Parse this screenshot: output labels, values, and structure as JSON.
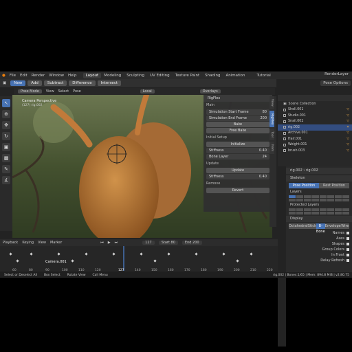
{
  "menubar": {
    "items": [
      "File",
      "Edit",
      "Render",
      "Window",
      "Help"
    ],
    "workspaces": [
      "Layout",
      "Modeling",
      "Sculpting",
      "UV Editing",
      "Texture Paint",
      "Shading",
      "Animation"
    ],
    "active_workspace": "Layout",
    "scene": "Tutorial",
    "view_layer": "RenderLayer"
  },
  "toolheader": {
    "buttons": [
      "New",
      "Add",
      "Subtract",
      "Difference",
      "Intersect"
    ],
    "active": "New",
    "options": "Pose Options"
  },
  "viewport_header": {
    "mode": "Pose Mode",
    "items": [
      "View",
      "Select",
      "Pose"
    ],
    "pivot": "Local",
    "overlays": "Overlays"
  },
  "viewport": {
    "camera_label": "Camera Perspective",
    "camera_sub": "(127) rig.002"
  },
  "rigflex": {
    "title": "RigFlex",
    "main_label": "Main",
    "sim_start_label": "Simulation Start Frame",
    "sim_start_value": "80",
    "sim_end_label": "Simulation End Frame",
    "sim_end_value": "200",
    "bake": "Bake",
    "free_bake": "Free Bake",
    "initial_setup": "Initial Setup",
    "initialize": "Initialize",
    "stiffness_label": "Stiffness",
    "stiffness_value": "0.40",
    "bone_layer_label": "Bone Layer",
    "bone_layer_value": "24",
    "update_label": "Update",
    "update_btn": "Update",
    "stiffness2_label": "Stiffness",
    "stiffness2_value": "0.40",
    "remove_label": "Remove",
    "revert": "Revert"
  },
  "ntabs": [
    "View",
    "RigFlex",
    "Tool",
    "Item"
  ],
  "outliner": {
    "title": "Scene Collection",
    "items": [
      "Shell.001",
      "Studio.001",
      "Snail.002",
      "rig.002",
      "Archive.001",
      "Hair.001",
      "Weight.001",
      "brush.003"
    ]
  },
  "properties": {
    "object": "rig.002",
    "data": "rig.002",
    "skeleton": "Skeleton",
    "pose_position": "Pose Position",
    "rest_position": "Rest Position",
    "layers": "Layers",
    "protected_layers": "Protected Layers",
    "display": "Display",
    "display_types": [
      "Octahedral",
      "Stick",
      "B-Bone",
      "Envelope",
      "Wire"
    ],
    "active_display": "B-Bone",
    "checks": [
      "Names",
      "Axes",
      "Shapes",
      "Group Colors",
      "In Front",
      "Delay Refresh"
    ]
  },
  "timeline": {
    "items": [
      "Playback",
      "Keying",
      "View",
      "Marker"
    ],
    "current_frame": "127",
    "start_label": "Start",
    "start_value": "80",
    "end_label": "End",
    "end_value": "200",
    "ruler": [
      "60",
      "80",
      "90",
      "100",
      "110",
      "120",
      "127",
      "140",
      "150",
      "160",
      "170",
      "180",
      "190",
      "200",
      "210",
      "220"
    ],
    "marker": "Camera.001"
  },
  "statusbar": {
    "left": [
      "Select or Deselect All",
      "Box Select",
      "Rotate View",
      "Call Menu"
    ],
    "right": "rig.002 | Bones:1/65 | Mem: 894.8 MiB | v2.80.75"
  }
}
